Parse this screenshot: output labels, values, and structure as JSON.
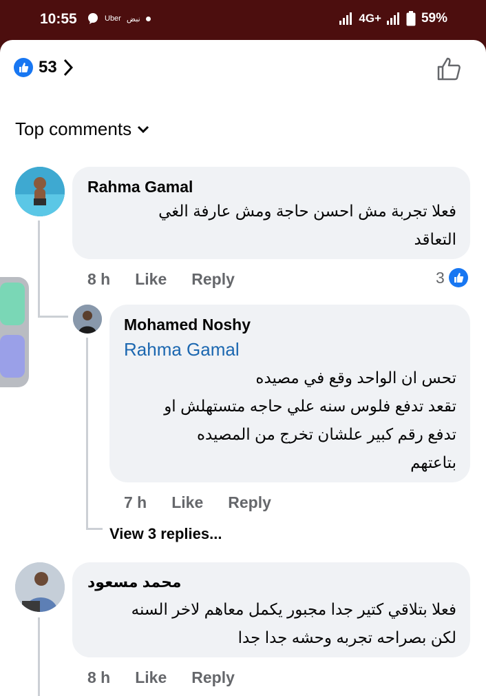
{
  "status_bar": {
    "time": "10:55",
    "uber_label": "Uber",
    "pulse_label": "نبض",
    "network": "4G+",
    "battery": "59%"
  },
  "reactions": {
    "count": "53"
  },
  "filter": {
    "label": "Top comments"
  },
  "comments": [
    {
      "author": "Rahma Gamal",
      "text_line1": "فعلا تجربة مش احسن حاجة ومش عارفة الغي",
      "text_line2": "التعاقد",
      "time": "8 h",
      "like_label": "Like",
      "reply_label": "Reply",
      "like_count": "3"
    },
    {
      "author": "Mohamed Noshy",
      "mention": "Rahma Gamal",
      "text_line1": "تحس ان الواحد وقع في مصيده",
      "text_line2": "تقعد تدفع فلوس سنه علي حاجه متستهلش او",
      "text_line3": "تدفع رقم كبير علشان تخرج من المصيده",
      "text_line4": "بتاعتهم",
      "time": "7 h",
      "like_label": "Like",
      "reply_label": "Reply",
      "view_replies": "View 3 replies..."
    },
    {
      "author": "محمد مسعود",
      "text_line1": "فعلا بتلاقي كتير جدا مجبور يكمل معاهم لاخر السنه",
      "text_line2": "لكن بصراحه تجربه وحشه جدا جدا",
      "time": "8 h",
      "like_label": "Like",
      "reply_label": "Reply"
    }
  ],
  "colors": {
    "status_bar": "#4c0e0e",
    "bubble": "#f0f2f5",
    "link": "#1b67b0",
    "like_blue": "#1877f2",
    "meta_gray": "#65676b"
  }
}
